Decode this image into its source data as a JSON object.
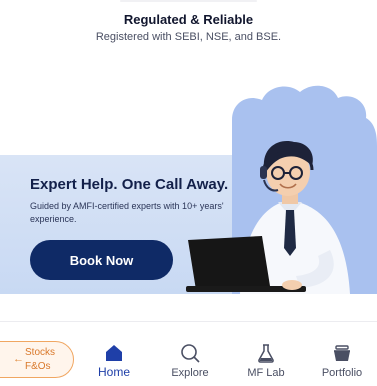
{
  "trust": {
    "title": "Regulated & Reliable",
    "subtitle": "Registered with SEBI, NSE, and BSE."
  },
  "banner": {
    "title": "Expert Help. One Call Away.",
    "description": "Guided by AMFI-certified experts with 10+ years' experience.",
    "cta_label": "Book Now",
    "illustration": "support-agent-with-headset-and-laptop-icon"
  },
  "bottom_nav": {
    "switcher": {
      "arrow": "←",
      "line1": "Stocks",
      "line2": "F&Os"
    },
    "items": [
      {
        "label": "Home",
        "icon": "home-icon",
        "active": true
      },
      {
        "label": "Explore",
        "icon": "search-icon",
        "active": false
      },
      {
        "label": "MF Lab",
        "icon": "flask-icon",
        "active": false
      },
      {
        "label": "Portfolio",
        "icon": "basket-icon",
        "active": false
      }
    ]
  },
  "colors": {
    "accent": "#1f3fa8",
    "button": "#0f2a66",
    "banner_bg": "#d3e0f5",
    "switcher": "#f0a661"
  }
}
